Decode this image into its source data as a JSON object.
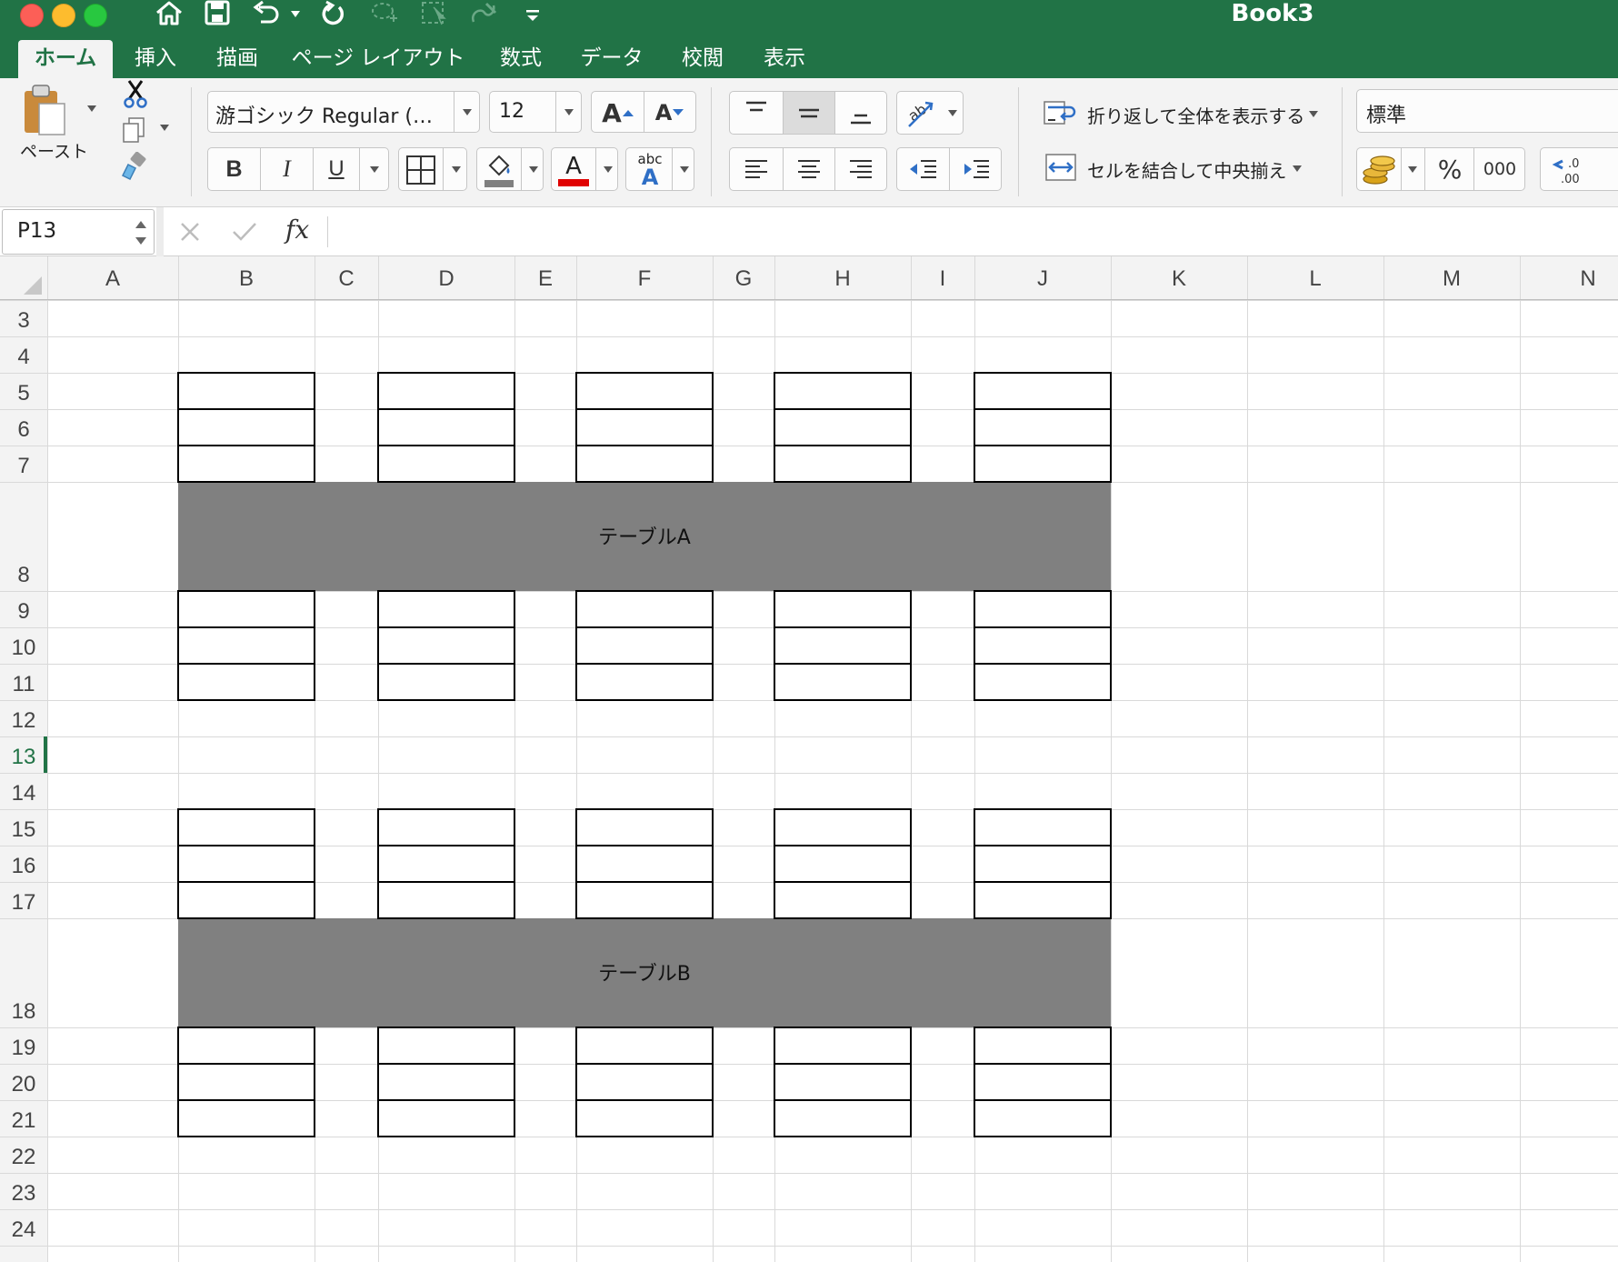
{
  "window": {
    "title": "Book3"
  },
  "tabs": [
    {
      "label": "ホーム",
      "active": true
    },
    {
      "label": "挿入"
    },
    {
      "label": "描画"
    },
    {
      "label": "ページ レイアウト"
    },
    {
      "label": "数式"
    },
    {
      "label": "データ"
    },
    {
      "label": "校閲"
    },
    {
      "label": "表示"
    }
  ],
  "ribbon": {
    "paste_label": "ペースト",
    "font_name": "游ゴシック Regular (…",
    "font_size": "12",
    "bold_label": "B",
    "italic_label": "I",
    "underline_label": "U",
    "wrap_text_label": "折り返して全体を表示する",
    "merge_center_label": "セルを結合して中央揃え",
    "number_format": "標準",
    "percent_label": "%",
    "comma_label": "000",
    "increase_font_label": "A",
    "decrease_font_label": "A",
    "font_color_label": "A",
    "phonetic_label": "abc",
    "font_color": "#e00000",
    "fill_color": "#808080",
    "accent": "#217346"
  },
  "formula_bar": {
    "name_box": "P13",
    "fx_label": "fx",
    "formula": ""
  },
  "sheet": {
    "columns": [
      "A",
      "B",
      "C",
      "D",
      "E",
      "F",
      "G",
      "H",
      "I",
      "J",
      "K",
      "L",
      "M",
      "N"
    ],
    "rows": [
      "3",
      "4",
      "5",
      "6",
      "7",
      "8",
      "9",
      "10",
      "11",
      "12",
      "13",
      "14",
      "15",
      "16",
      "17",
      "18",
      "19",
      "20",
      "21",
      "22",
      "23",
      "24"
    ],
    "active_row": "13",
    "merged_cells": [
      {
        "text": "テーブルA",
        "fill": "#808080"
      },
      {
        "text": "テーブルB",
        "fill": "#808080"
      }
    ]
  }
}
